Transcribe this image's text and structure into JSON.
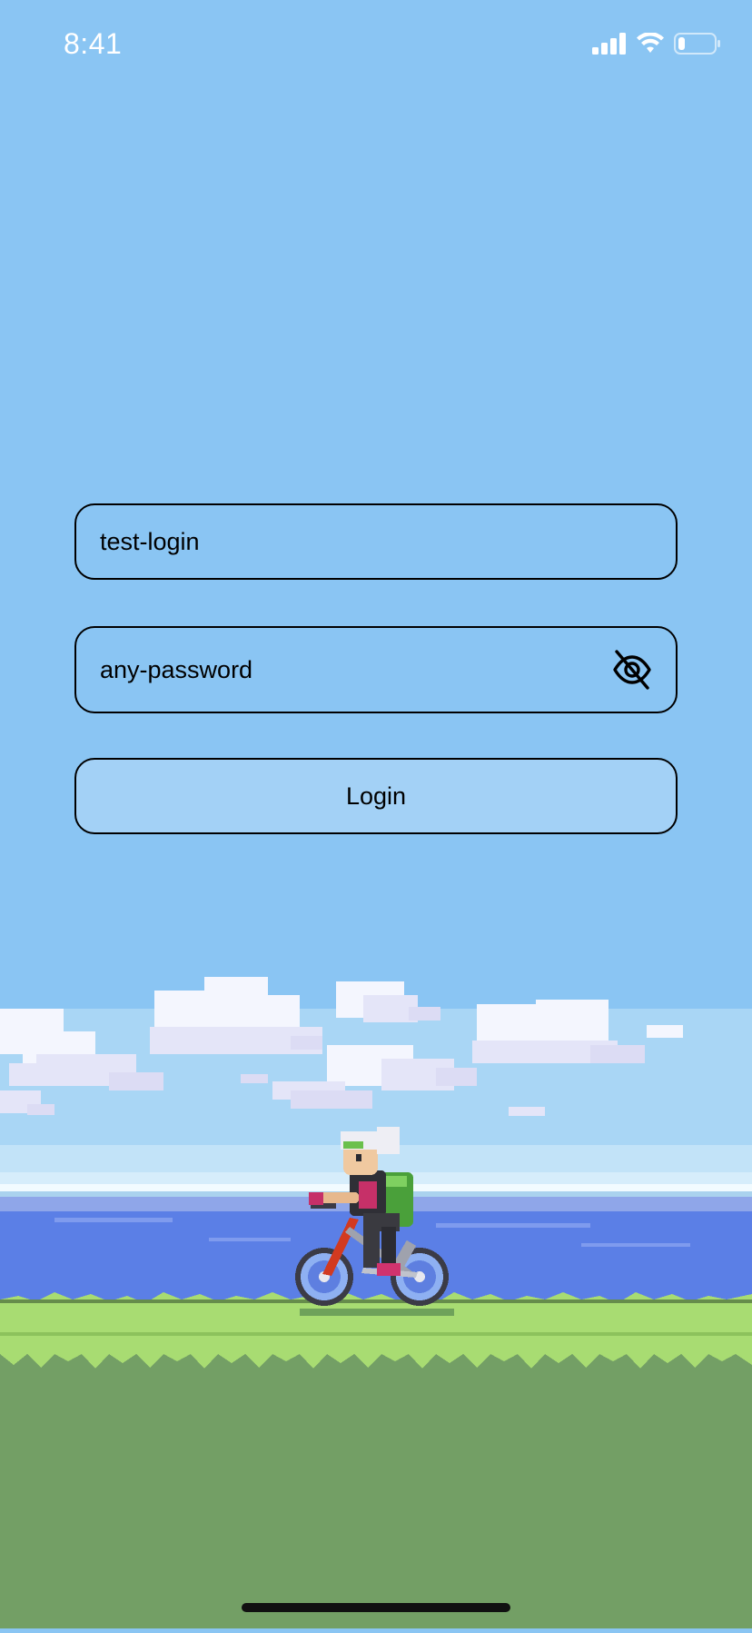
{
  "status_bar": {
    "time": "8:41",
    "icons": [
      "signal-icon",
      "wifi-icon",
      "battery-icon"
    ],
    "battery_level": 0.2
  },
  "login_form": {
    "login_value": "test-login",
    "password_value": "any-password",
    "password_toggle_icon": "eye-off-icon",
    "login_button_label": "Login"
  },
  "colors": {
    "sky": "#8ac5f3",
    "sea": "#5b7fe6",
    "grass_light": "#a8dc72",
    "grass_dark": "#739f65",
    "button_fill": "#a3d1f6",
    "border": "#000000"
  },
  "illustration": {
    "icon": "cyclist-illustration"
  }
}
